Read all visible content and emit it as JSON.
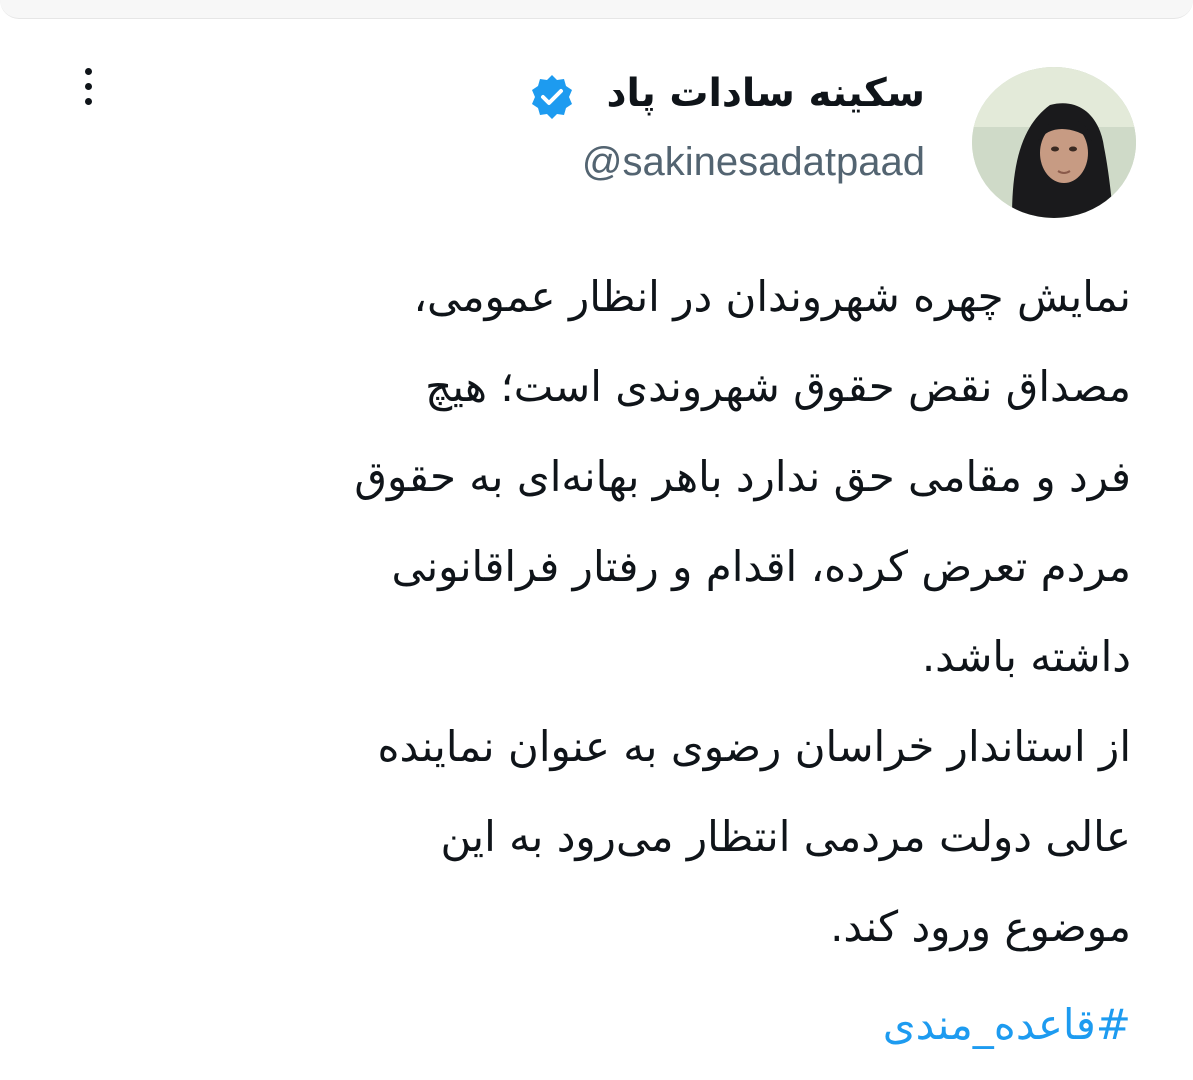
{
  "author": {
    "display_name": "سکینه سادات پاد",
    "handle": "@sakinesadatpaad",
    "verified": true,
    "verified_color": "#1d9bf0"
  },
  "tweet": {
    "lines": [
      "نمایش چهره شهروندان در انظار عمومی،",
      "مصداق نقض حقوق شهروندی است؛ هیچ",
      "فرد و مقامی حق ندارد باهر بهانه‌ای به حقوق",
      "مردم تعرض کرده، اقدام و رفتار فراقانونی",
      "داشته باشد.",
      "از استاندار خراسان رضوی به عنوان نماینده",
      "عالی دولت مردمی انتظار می‌رود به این",
      "موضوع ورود کند."
    ],
    "hashtag": "#قاعده_مندی"
  },
  "colors": {
    "text": "#0f1419",
    "secondary": "#536471",
    "link": "#1d9bf0"
  }
}
